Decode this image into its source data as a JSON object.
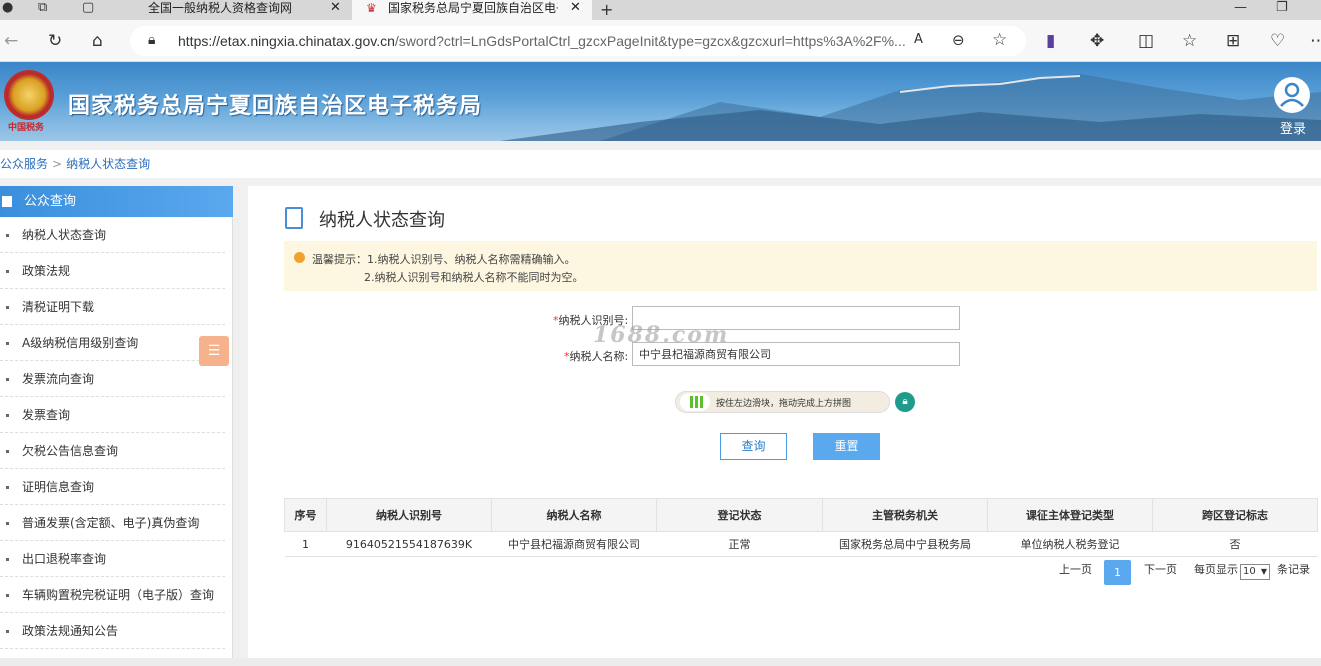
{
  "browser": {
    "tabs": [
      {
        "title": "全国一般纳税人资格查询网",
        "active": false
      },
      {
        "title": "国家税务总局宁夏回族自治区电子",
        "active": true
      }
    ],
    "url_main": "https://etax.ningxia.chinatax.gov.cn",
    "url_rest": "/sword?ctrl=LnGdsPortalCtrl_gzcxPageInit&type=gzcx&gzcxurl=https%3A%2F%..."
  },
  "banner": {
    "emblem_text": "中国税务",
    "title": "国家税务总局宁夏回族自治区电子税务局",
    "login_label": "登录"
  },
  "breadcrumb": {
    "root": "公众服务",
    "separator": ">",
    "current": "纳税人状态查询"
  },
  "sidebar": {
    "header": "公众查询",
    "items": [
      "纳税人状态查询",
      "政策法规",
      "清税证明下载",
      "A级纳税信用级别查询",
      "发票流向查询",
      "发票查询",
      "欠税公告信息查询",
      "证明信息查询",
      "普通发票(含定额、电子)真伪查询",
      "出口退税率查询",
      "车辆购置税完税证明（电子版）查询",
      "政策法规通知公告"
    ]
  },
  "main": {
    "title": "纳税人状态查询",
    "notice_line1": "温馨提示：1.纳税人识别号、纳税人名称需精确输入。",
    "notice_line2": "2.纳税人识别号和纳税人名称不能同时为空。",
    "form": {
      "id_label": "纳税人识别号:",
      "id_value": "",
      "name_label": "纳税人名称:",
      "name_value": "中宁县杞福源商贸有限公司",
      "required_mark": "*"
    },
    "watermark": "1688.com",
    "slider_text": "按住左边滑块，拖动完成上方拼图",
    "query_button": "查询",
    "reset_button": "重置"
  },
  "table": {
    "headers": [
      "序号",
      "纳税人识别号",
      "纳税人名称",
      "登记状态",
      "主管税务机关",
      "课征主体登记类型",
      "跨区登记标志"
    ],
    "rows": [
      [
        "1",
        "91640521554187639K",
        "中宁县杞福源商贸有限公司",
        "正常",
        "国家税务总局中宁县税务局",
        "单位纳税人税务登记",
        "否"
      ]
    ]
  },
  "pager": {
    "prev": "上一页",
    "current": "1",
    "next": "下一页",
    "per_page_label": "每页显示",
    "per_page_value": "10",
    "records_label": "条记录"
  }
}
